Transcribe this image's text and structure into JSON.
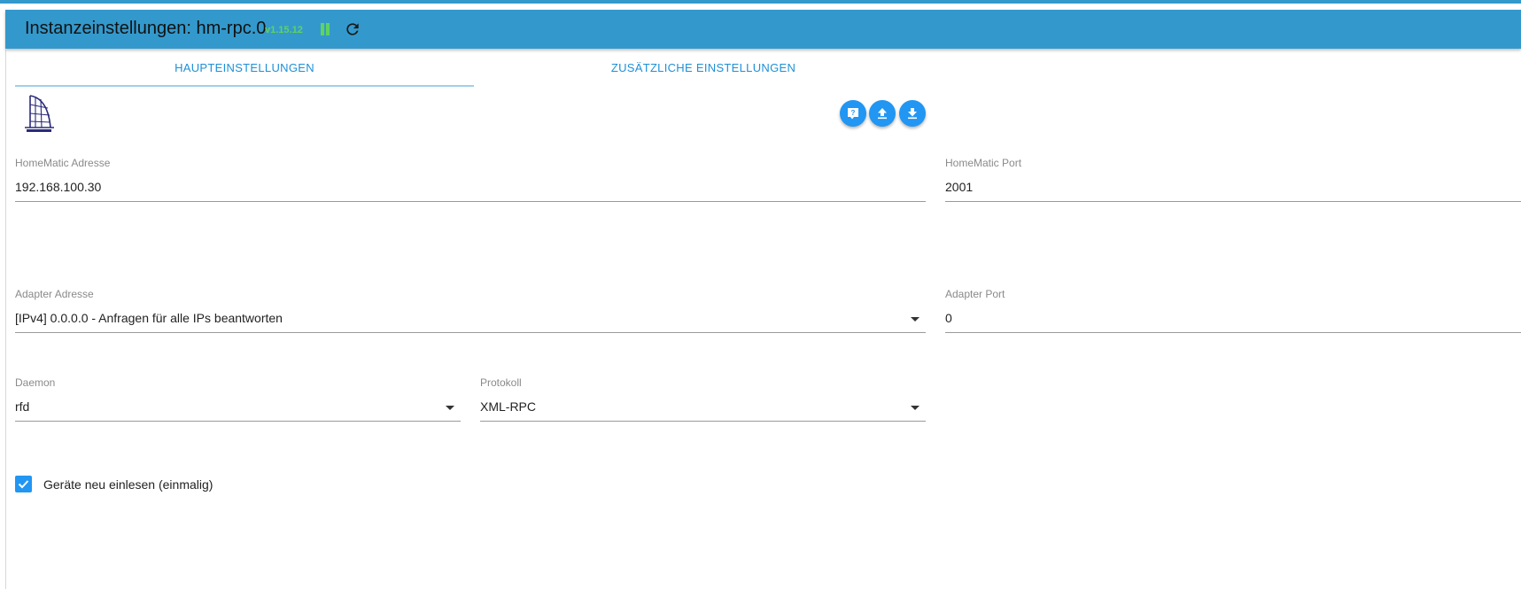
{
  "header": {
    "title": "Instanzeinstellungen: hm-rpc.0",
    "version": "v1.15.12",
    "accent_color": "#3399cc",
    "status_color": "#5fd35f",
    "icons": [
      "pause-icon",
      "reload-icon"
    ]
  },
  "tabs": [
    {
      "label": "HAUPTEINSTELLUNGEN",
      "active": true
    },
    {
      "label": "ZUSÄTZLICHE EINSTELLUNGEN",
      "active": false
    }
  ],
  "toolbar": {
    "logo": "homematic-logo",
    "buttons": [
      {
        "icon": "help-icon"
      },
      {
        "icon": "upload-icon"
      },
      {
        "icon": "download-icon"
      }
    ],
    "button_color": "#2196f3"
  },
  "fields": {
    "homematic_address": {
      "label": "HomeMatic Adresse",
      "value": "192.168.100.30"
    },
    "homematic_port": {
      "label": "HomeMatic Port",
      "value": "2001"
    },
    "adapter_address": {
      "label": "Adapter Adresse",
      "value": "[IPv4] 0.0.0.0 - Anfragen für alle IPs beantworten"
    },
    "adapter_port": {
      "label": "Adapter Port",
      "value": "0"
    },
    "daemon": {
      "label": "Daemon",
      "value": "rfd"
    },
    "protocol": {
      "label": "Protokoll",
      "value": "XML-RPC"
    }
  },
  "checkbox": {
    "label": "Geräte neu einlesen (einmalig)",
    "checked": true
  }
}
